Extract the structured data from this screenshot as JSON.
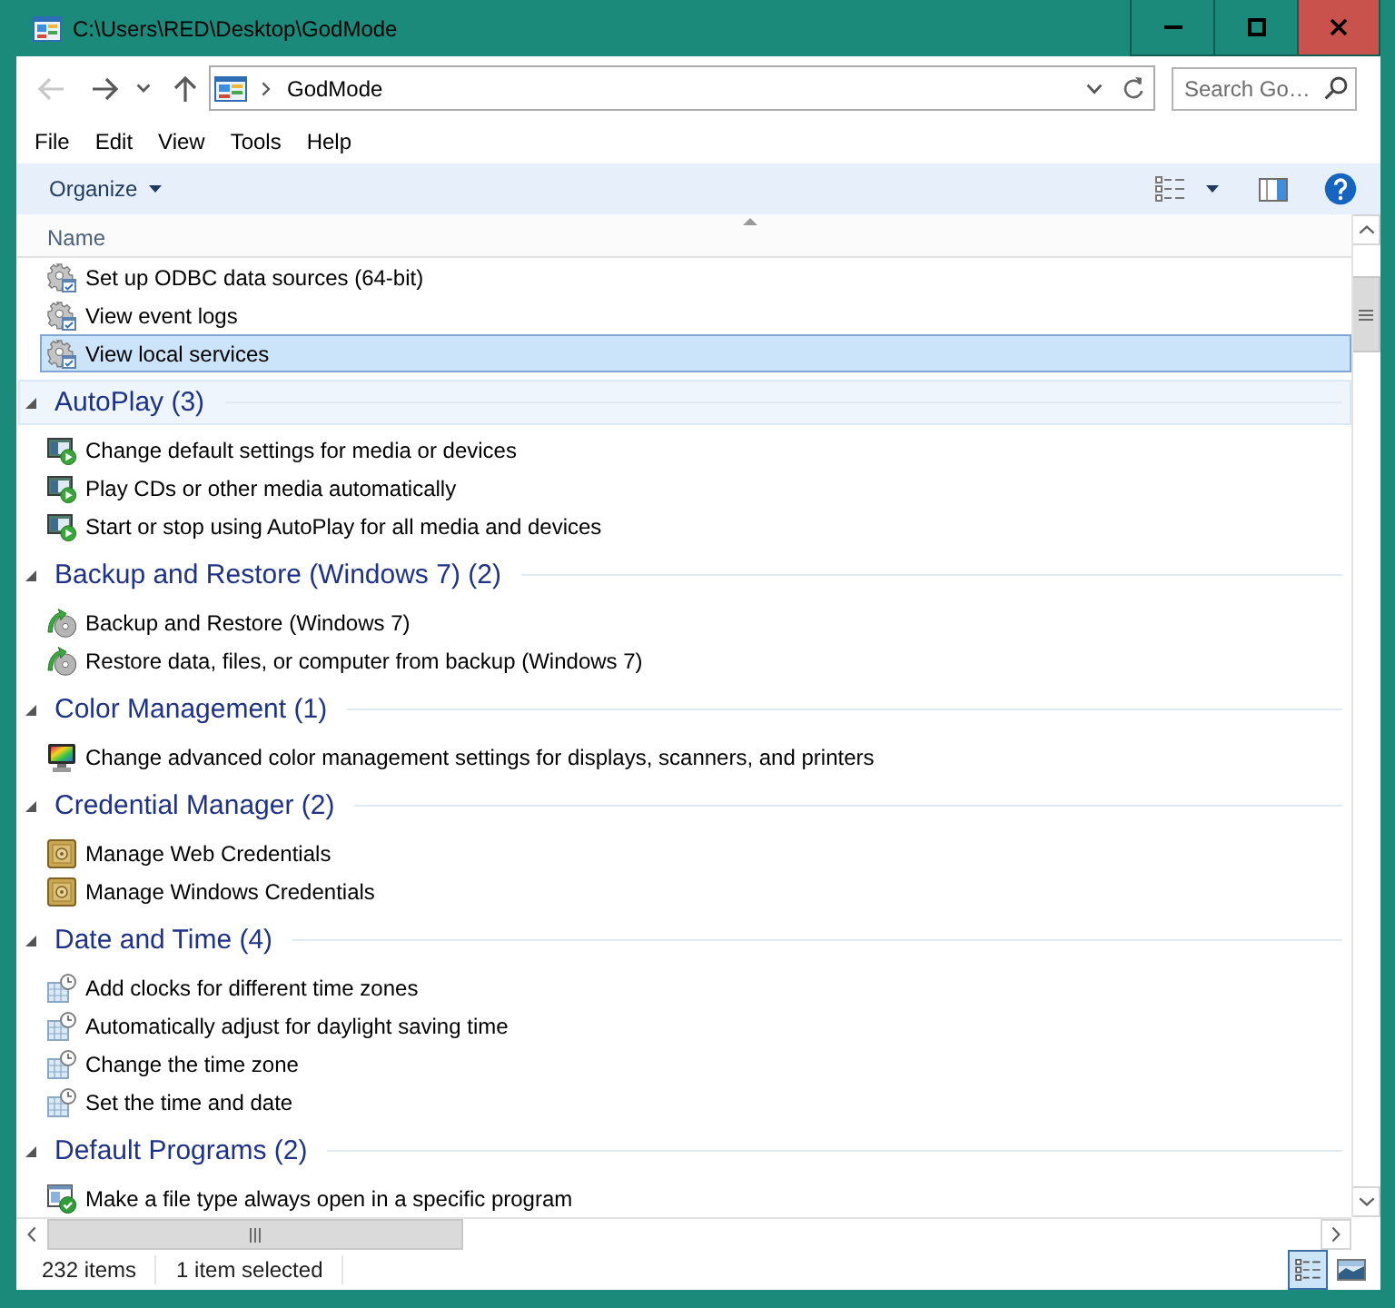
{
  "window": {
    "title": "C:\\Users\\RED\\Desktop\\GodMode"
  },
  "navigation": [
    {
      "kind": "back",
      "disabled": true
    },
    {
      "kind": "forward",
      "disabled": false
    },
    {
      "kind": "recent",
      "disabled": false
    },
    {
      "kind": "up",
      "disabled": false
    }
  ],
  "address_bar": {
    "path": [
      "GodMode"
    ]
  },
  "search": {
    "placeholder": "Search Go…"
  },
  "menu": [
    "File",
    "Edit",
    "View",
    "Tools",
    "Help"
  ],
  "command_bar": {
    "organize": "Organize"
  },
  "columns": [
    {
      "label": "Name",
      "sort_ascending": true
    }
  ],
  "groups": [
    {
      "kind": "admin",
      "items": [
        {
          "label": "Set up ODBC data sources (64-bit)",
          "selected": false
        },
        {
          "label": "View event logs",
          "selected": false
        },
        {
          "label": "View local services",
          "selected": true
        }
      ]
    },
    {
      "title": "AutoPlay (3)",
      "kind": "autoplay",
      "expanded": true,
      "focused": true,
      "items": [
        {
          "label": "Change default settings for media or devices",
          "selected": false
        },
        {
          "label": "Play CDs or other media automatically",
          "selected": false
        },
        {
          "label": "Start or stop using AutoPlay for all media and devices",
          "selected": false
        }
      ]
    },
    {
      "title": "Backup and Restore (Windows 7) (2)",
      "kind": "backup",
      "expanded": true,
      "focused": false,
      "items": [
        {
          "label": "Backup and Restore (Windows 7)",
          "selected": false
        },
        {
          "label": "Restore data, files, or computer from backup (Windows 7)",
          "selected": false
        }
      ]
    },
    {
      "title": "Color Management (1)",
      "kind": "color",
      "expanded": true,
      "focused": false,
      "items": [
        {
          "label": "Change advanced color management settings for displays, scanners, and printers",
          "selected": false
        }
      ]
    },
    {
      "title": "Credential Manager (2)",
      "kind": "credential",
      "expanded": true,
      "focused": false,
      "items": [
        {
          "label": "Manage Web Credentials",
          "selected": false
        },
        {
          "label": "Manage Windows Credentials",
          "selected": false
        }
      ]
    },
    {
      "title": "Date and Time (4)",
      "kind": "datetime",
      "expanded": true,
      "focused": false,
      "items": [
        {
          "label": "Add clocks for different time zones",
          "selected": false
        },
        {
          "label": "Automatically adjust for daylight saving time",
          "selected": false
        },
        {
          "label": "Change the time zone",
          "selected": false
        },
        {
          "label": "Set the time and date",
          "selected": false
        }
      ]
    },
    {
      "title": "Default Programs (2)",
      "kind": "defaultprograms",
      "expanded": true,
      "focused": false,
      "items": [
        {
          "label": "Make a file type always open in a specific program",
          "selected": false
        }
      ]
    }
  ],
  "status_bar": {
    "item_count": "232 items",
    "selection": "1 item selected"
  },
  "view_buttons": [
    {
      "kind": "details",
      "selected": true
    },
    {
      "kind": "large_icons",
      "selected": false
    }
  ]
}
